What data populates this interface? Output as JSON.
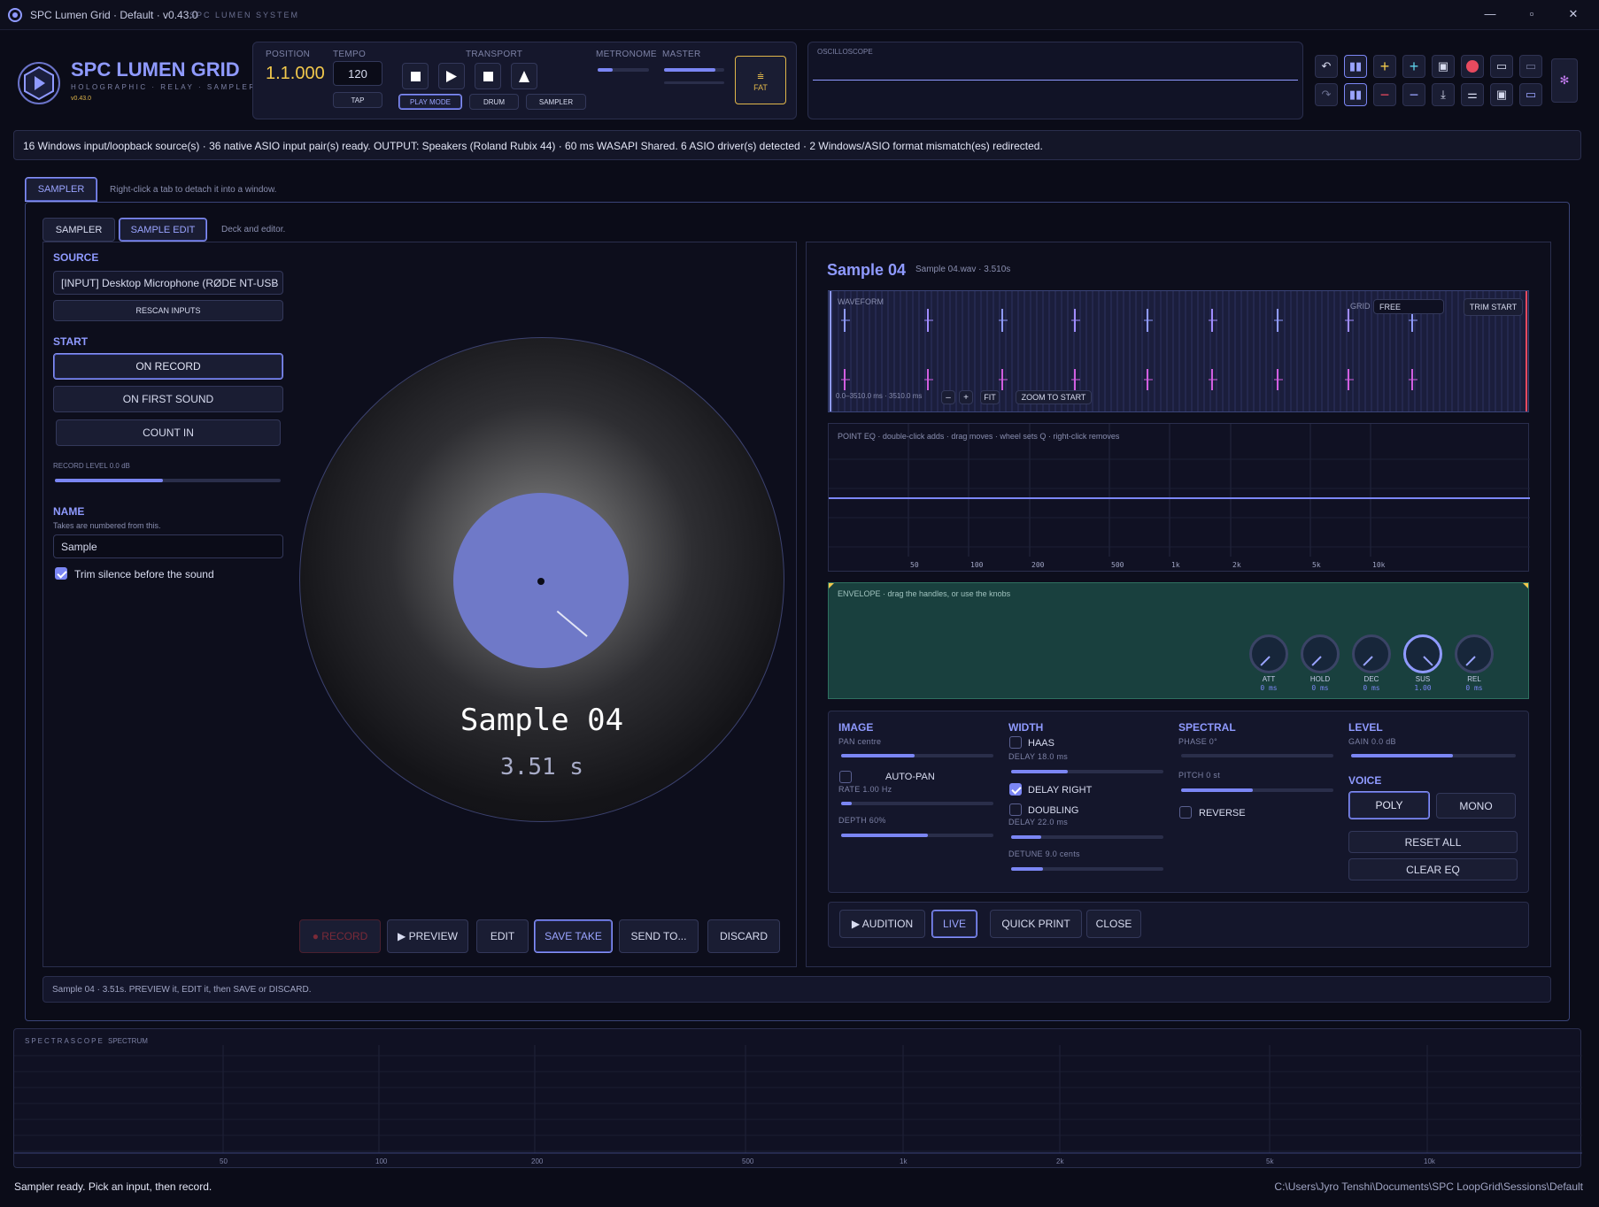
{
  "window": {
    "title": "SPC Lumen Grid · Default · v0.43.0",
    "subtitle": "SPC LUMEN SYSTEM",
    "min": "—",
    "max": "▫",
    "close": "✕"
  },
  "brand": {
    "name": "SPC LUMEN GRID",
    "tagline": "HOLOGRAPHIC · RELAY · SAMPLER",
    "version": "v0.43.0"
  },
  "transport": {
    "position_label": "POSITION",
    "position": "1.1.000",
    "tempo_label": "TEMPO",
    "tempo": "120",
    "tap": "TAP",
    "transport_label": "TRANSPORT",
    "play_mode": "PLAY MODE",
    "drum": "DRUM",
    "sampler": "SAMPLER",
    "metronome_label": "METRONOME",
    "metronome_level": 0.3,
    "master_label": "MASTER",
    "master_level": 0.85,
    "fat": "FAT",
    "oscilloscope_label": "OSCILLOSCOPE"
  },
  "status_banner": "16 Windows input/loopback source(s) · 36 native ASIO input pair(s) ready. OUTPUT: Speakers (Roland Rubix 44) · 60 ms WASAPI Shared. 6 ASIO driver(s) detected · 2 Windows/ASIO format mismatch(es) redirected.",
  "tabs": {
    "main": "SAMPLER",
    "hint": "Right-click a tab to detach it into a window.",
    "inner": [
      "SAMPLER",
      "SAMPLE EDIT"
    ],
    "inner_hint": "Deck and editor."
  },
  "source": {
    "label": "SOURCE",
    "device": "[INPUT] Desktop Microphone (RØDE NT-USB",
    "rescan": "RESCAN INPUTS",
    "start_label": "START",
    "on_record": "ON RECORD",
    "on_first_sound": "ON FIRST SOUND",
    "count_in": "COUNT IN",
    "record_level_label": "RECORD LEVEL 0.0 dB",
    "record_level": 0.48,
    "name_label": "NAME",
    "name_hint": "Takes are numbered from this.",
    "name_value": "Sample",
    "trim_label": "Trim silence before the sound",
    "trim_checked": true
  },
  "deck": {
    "sample_name": "Sample 04",
    "duration": "3.51 s"
  },
  "actions": {
    "record": "● RECORD",
    "preview": "▶ PREVIEW",
    "edit": "EDIT",
    "save_take": "SAVE TAKE",
    "send_to": "SEND TO...",
    "discard": "DISCARD"
  },
  "editor": {
    "title": "Sample 04",
    "file_info": "Sample 04.wav · 3.510s",
    "waveform_label": "WAVEFORM",
    "grid_label": "GRID",
    "grid_value": "FREE",
    "trim_start": "TRIM START",
    "range": "0.0–3510.0 ms · 3510.0 ms",
    "zoom_out": "–",
    "zoom_in": "+",
    "fit": "FIT",
    "zoom_to_start": "ZOOM TO START",
    "eq_label": "POINT EQ · double-click adds · drag moves · wheel sets Q · right-click removes",
    "eq_ticks": [
      "50",
      "100",
      "200",
      "500",
      "1k",
      "2k",
      "5k",
      "10k"
    ],
    "envelope_label": "ENVELOPE · drag the handles, or use the knobs",
    "knobs": [
      {
        "name": "ATT",
        "value": "0 ms",
        "amount": 0.0
      },
      {
        "name": "HOLD",
        "value": "0 ms",
        "amount": 0.0
      },
      {
        "name": "DEC",
        "value": "0 ms",
        "amount": 0.0
      },
      {
        "name": "SUS",
        "value": "1.00",
        "amount": 1.0
      },
      {
        "name": "REL",
        "value": "0 ms",
        "amount": 0.0
      }
    ]
  },
  "fx": {
    "image": {
      "header": "IMAGE",
      "pan_label": "PAN centre",
      "pan": 0.48,
      "autopan": "AUTO-PAN",
      "autopan_checked": false,
      "rate_label": "RATE 1.00 Hz",
      "rate": 0.07,
      "depth_label": "DEPTH 60%",
      "depth": 0.57
    },
    "width": {
      "header": "WIDTH",
      "haas": "HAAS",
      "haas_checked": false,
      "delay_label": "DELAY 18.0 ms",
      "delay": 0.37,
      "delay_right": "DELAY RIGHT",
      "delay_right_checked": true,
      "doubling": "DOUBLING",
      "doubling_checked": false,
      "delay2_label": "DELAY 22.0 ms",
      "delay2": 0.2,
      "detune_label": "DETUNE 9.0 cents",
      "detune": 0.21
    },
    "spectral": {
      "header": "SPECTRAL",
      "phase_label": "PHASE 0°",
      "phase": 0.0,
      "pitch_label": "PITCH 0 st",
      "pitch": 0.47,
      "reverse": "REVERSE",
      "reverse_checked": false
    },
    "level": {
      "header": "LEVEL",
      "gain_label": "GAIN 0.0 dB",
      "gain": 0.62,
      "voice_header": "VOICE",
      "poly": "POLY",
      "mono": "MONO",
      "reset_all": "RESET ALL",
      "clear_eq": "CLEAR EQ"
    }
  },
  "audition": {
    "audition": "▶ AUDITION",
    "live": "LIVE",
    "quick_print": "QUICK PRINT",
    "close": "CLOSE"
  },
  "hint_bar": "Sample 04 · 3.51s. PREVIEW it, EDIT it, then SAVE or DISCARD.",
  "spectrascope": {
    "label": "SPECTRASCOPE",
    "mode": "SPECTRUM",
    "ticks": [
      "50",
      "100",
      "200",
      "500",
      "1k",
      "2k",
      "5k",
      "10k"
    ]
  },
  "footer": {
    "status": "Sampler ready. Pick an input, then record.",
    "path": "C:\\Users\\Jyro Tenshi\\Documents\\SPC LoopGrid\\Sessions\\Default"
  },
  "colors": {
    "accent": "#7b86f4",
    "background": "#0b0c18",
    "panel": "#13152a",
    "gold": "#f2c94c",
    "record": "#e84a5f"
  }
}
